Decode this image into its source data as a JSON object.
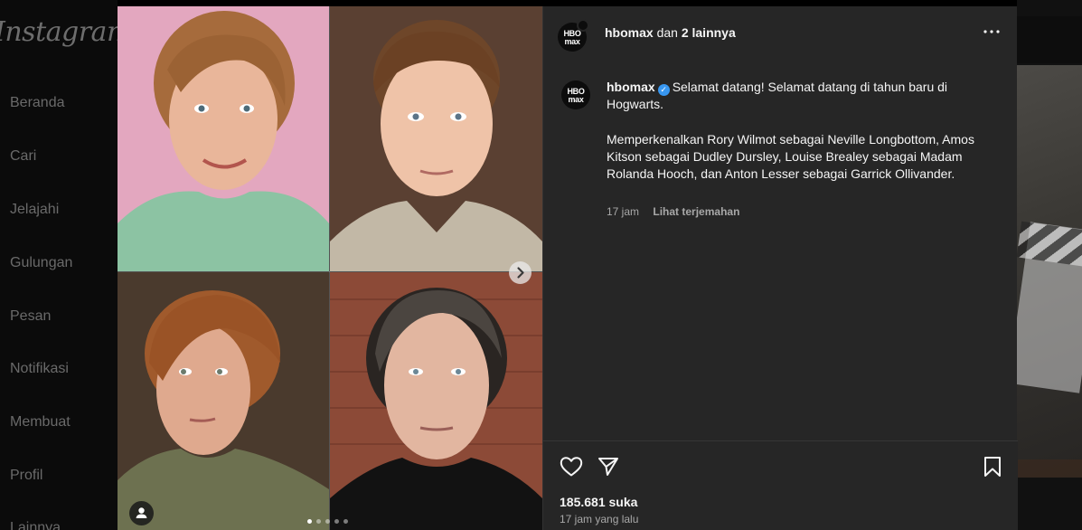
{
  "sidebar": {
    "brand": "Instagram",
    "items": [
      {
        "label": "Beranda"
      },
      {
        "label": "Cari"
      },
      {
        "label": "Jelajahi"
      },
      {
        "label": "Gulungan"
      },
      {
        "label": "Pesan"
      },
      {
        "label": "Notifikasi"
      },
      {
        "label": "Membuat"
      },
      {
        "label": "Profil"
      },
      {
        "label": "Lainnya"
      }
    ]
  },
  "post": {
    "author": "hbomax",
    "collab_text": "dan",
    "collab_others": "2 lainnya",
    "avatar_text": "HBO max",
    "caption_line1": "Selamat datang! Selamat datang di tahun baru di Hogwarts.",
    "caption_line2": "Memperkenalkan Rory Wilmot sebagai Neville Longbottom, Amos Kitson sebagai Dudley Dursley, Louise Brealey sebagai Madam Rolanda Hooch, dan Anton Lesser sebagai Garrick Ollivander.",
    "caption_time": "17 jam",
    "translate_label": "Lihat terjemahan",
    "likes": "185.681 suka",
    "posted_time": "17 jam yang lalu",
    "carousel_count": 5,
    "carousel_active": 1
  },
  "icons": {
    "more": "more-options-icon",
    "like": "heart-icon",
    "share": "send-icon",
    "save": "bookmark-icon",
    "next": "chevron-right-icon",
    "tag": "user-tag-icon",
    "verified": "verified-badge-icon"
  },
  "colors": {
    "panel_bg": "#262626",
    "text": "#f5f5f5",
    "muted": "#a8a8a8",
    "verified": "#3897f0"
  }
}
